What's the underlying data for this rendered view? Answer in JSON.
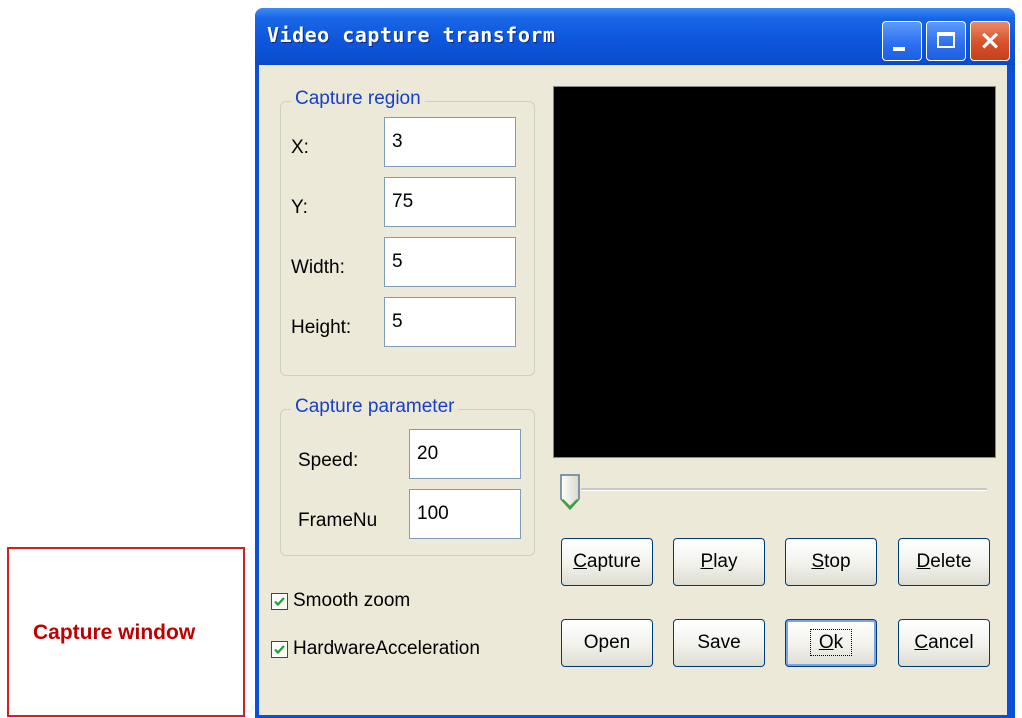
{
  "window": {
    "title": "Video capture transform",
    "buttons": {
      "minimize": "minimize-icon",
      "maximize": "maximize-icon",
      "close": "×"
    }
  },
  "capture_region": {
    "legend": "Capture region",
    "fields": [
      {
        "label": "X:",
        "value": "3"
      },
      {
        "label": "Y:",
        "value": "75"
      },
      {
        "label": "Width:",
        "value": "5"
      },
      {
        "label": "Height:",
        "value": "5"
      }
    ]
  },
  "capture_parameter": {
    "legend": "Capture parameter",
    "fields": [
      {
        "label": "Speed:",
        "value": "20"
      },
      {
        "label": "FrameNu",
        "value": "100"
      }
    ]
  },
  "options": {
    "smooth_zoom": {
      "label": "Smooth zoom",
      "checked": true
    },
    "hardware_acceleration": {
      "label": "HardwareAcceleration",
      "checked": true
    }
  },
  "slider": {
    "position": 0
  },
  "buttons": {
    "capture": {
      "mn": "C",
      "rest": "apture"
    },
    "play": {
      "mn": "P",
      "rest": "lay"
    },
    "stop": {
      "mn": "S",
      "rest": "top"
    },
    "delete": {
      "mn": "D",
      "rest": "elete"
    },
    "open": {
      "label": "Open"
    },
    "save": {
      "label": "Save"
    },
    "ok": {
      "mn": "O",
      "rest": "k"
    },
    "cancel": {
      "mn": "C",
      "rest": "ancel"
    }
  },
  "annotation": {
    "label": "Capture window"
  },
  "colors": {
    "title_bar": "#0a4fd8",
    "legend_text": "#1640c8",
    "annotation": "#c00000",
    "dialog_bg": "#ece9d8"
  }
}
